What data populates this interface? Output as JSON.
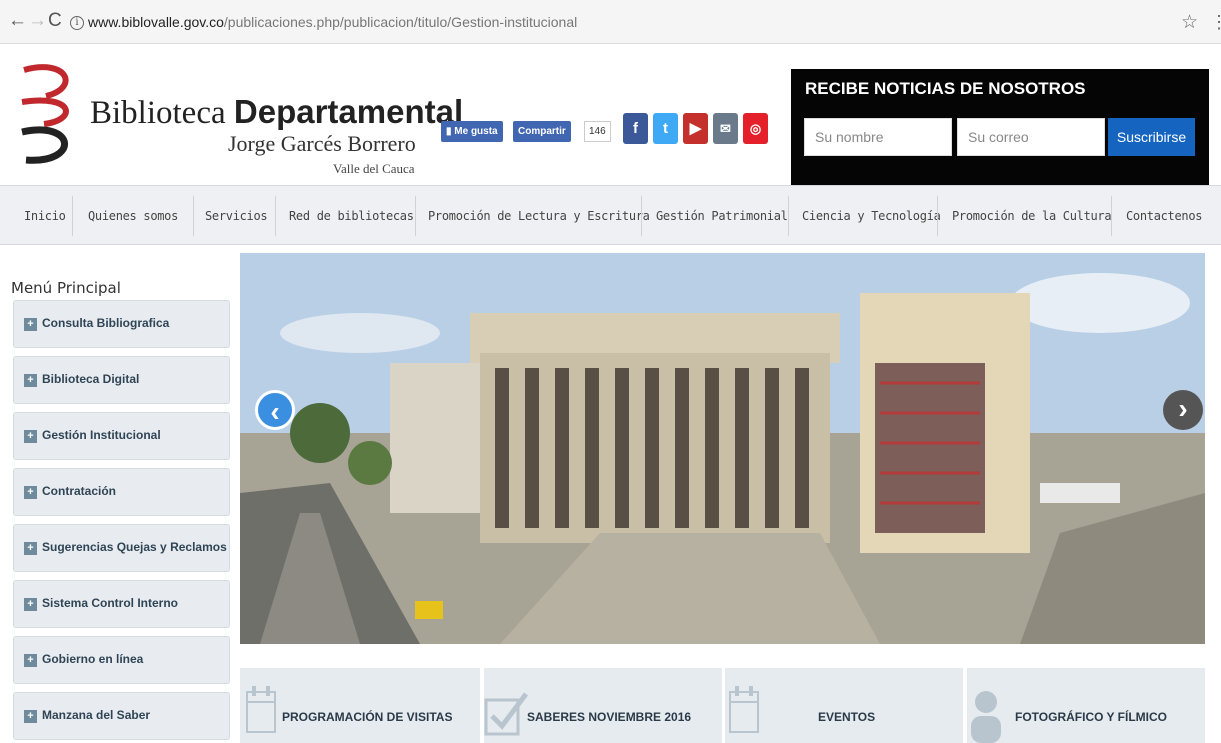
{
  "browser": {
    "url_domain": "www.biblovalle.gov.co",
    "url_path": "/publicaciones.php/publicacion/titulo/Gestion-institucional"
  },
  "header": {
    "brand_line1_a": "Biblioteca ",
    "brand_line1_b": "Departamental",
    "brand_line2": "Jorge Garcés Borrero",
    "brand_line3": "Valle del Cauca",
    "like_label": "Me gusta",
    "share_label": "Compartir",
    "share_count": "146",
    "social_icons": [
      "facebook-icon",
      "twitter-icon",
      "youtube-icon",
      "mail-icon",
      "instagram-icon"
    ]
  },
  "newsletter": {
    "title": "RECIBE NOTICIAS DE NOSOTROS",
    "name_placeholder": "Su nombre",
    "email_placeholder": "Su correo",
    "button": "Suscribirse"
  },
  "menu": [
    "Inicio",
    "Quienes somos",
    "Servicios",
    "Red de bibliotecas",
    "Promoción de Lectura y Escritura",
    "Gestión Patrimonial",
    "Ciencia y Tecnología",
    "Promoción de la Cultura",
    "Contactenos"
  ],
  "sidebar": {
    "title": "Menú Principal",
    "items": [
      "Consulta Bibliografica",
      "Biblioteca Digital",
      "Gestión Institucional",
      "Contratación",
      "Sugerencias Quejas y Reclamos",
      "Sistema Control Interno",
      "Gobierno en línea",
      "Manzana del Saber"
    ]
  },
  "cards": [
    "PROGRAMACIÓN DE VISITAS",
    "SABERES NOVIEMBRE 2016",
    "EVENTOS",
    "FOTOGRÁFICO Y FÍLMICO"
  ],
  "colors": {
    "accent": "#1565c0",
    "sidebar_text": "#2f4455",
    "card_bg": "#e6ebef"
  }
}
